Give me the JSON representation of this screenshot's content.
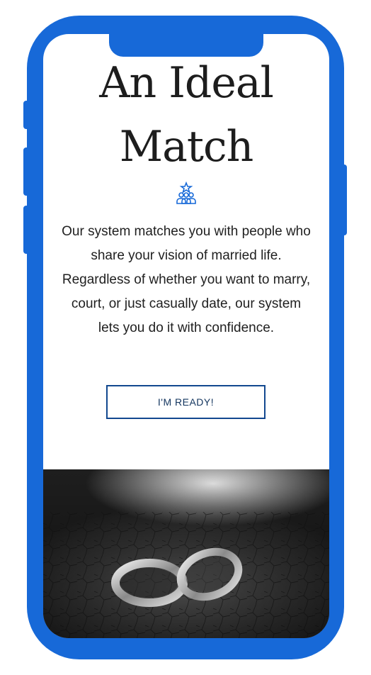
{
  "hero": {
    "title_line1": "An Ideal",
    "title_line2": "Match"
  },
  "icons": {
    "couple": "couple-star-icon"
  },
  "description": "Our system matches you with people who share your vision of married life. Regardless of whether you want to marry, court, or just casually date, our system lets you do it with confidence.",
  "cta": {
    "label": "I'M READY!"
  },
  "colors": {
    "frame": "#1769d8",
    "accent": "#1769d8",
    "button_border": "#12488f",
    "text": "#1f1f1f"
  }
}
